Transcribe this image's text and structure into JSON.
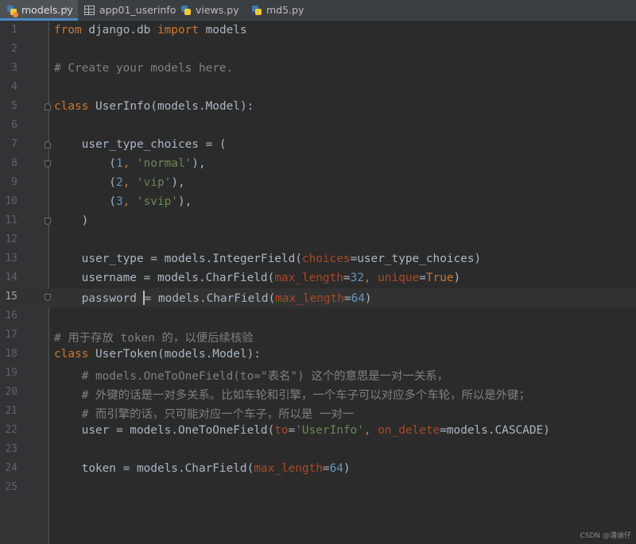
{
  "tabs": [
    {
      "label": "models.py",
      "icon": "python-file-icon",
      "active": true
    },
    {
      "label": "app01_userinfo",
      "icon": "table-icon",
      "active": false
    },
    {
      "label": "views.py",
      "icon": "python-file-icon",
      "active": false
    },
    {
      "label": "md5.py",
      "icon": "python-file-icon",
      "active": false
    }
  ],
  "tab_close_glyph": "×",
  "current_line": 15,
  "colors": {
    "background": "#2b2b2b",
    "gutter": "#313335",
    "keyword": "#cc7832",
    "comment": "#808080",
    "string": "#6a8759",
    "number": "#6897bb",
    "parameter": "#aa4926",
    "default_text": "#a9b7c6",
    "tab_underline": "#4a88c7"
  },
  "lines": [
    {
      "n": "1",
      "tokens": [
        [
          "kw",
          "from"
        ],
        [
          "",
          "django.db"
        ],
        [
          "kw",
          "import"
        ],
        [
          "",
          "models"
        ]
      ]
    },
    {
      "n": "2",
      "tokens": []
    },
    {
      "n": "3",
      "tokens": [
        [
          "cm",
          "# Create your models here."
        ]
      ]
    },
    {
      "n": "4",
      "tokens": []
    },
    {
      "n": "5",
      "tokens": [
        [
          "kw",
          "class"
        ],
        [
          "",
          "UserInfo(models.Model):"
        ]
      ]
    },
    {
      "n": "6",
      "tokens": []
    },
    {
      "n": "7",
      "tokens": [
        [
          "",
          "    user_type_choices = ("
        ]
      ]
    },
    {
      "n": "8",
      "tokens": [
        [
          "",
          "        ("
        ],
        [
          "num",
          "1"
        ],
        [
          "kw",
          ", "
        ],
        [
          "str",
          "'normal'"
        ],
        [
          "",
          "),"
        ]
      ]
    },
    {
      "n": "9",
      "tokens": [
        [
          "",
          "        ("
        ],
        [
          "num",
          "2"
        ],
        [
          "kw",
          ", "
        ],
        [
          "str",
          "'vip'"
        ],
        [
          "",
          "),"
        ]
      ]
    },
    {
      "n": "10",
      "tokens": [
        [
          "",
          "        ("
        ],
        [
          "num",
          "3"
        ],
        [
          "kw",
          ", "
        ],
        [
          "str",
          "'svip'"
        ],
        [
          "",
          "),"
        ]
      ]
    },
    {
      "n": "11",
      "tokens": [
        [
          "",
          "    )"
        ]
      ]
    },
    {
      "n": "12",
      "tokens": []
    },
    {
      "n": "13",
      "tokens": [
        [
          "",
          "    user_type = models.IntegerField("
        ],
        [
          "prm",
          "choices"
        ],
        [
          "",
          "=user_type_choices)"
        ]
      ]
    },
    {
      "n": "14",
      "tokens": [
        [
          "",
          "    username = models.CharField("
        ],
        [
          "prm",
          "max_length"
        ],
        [
          "",
          "="
        ],
        [
          "num",
          "32"
        ],
        [
          "kw",
          ", "
        ],
        [
          "prm",
          "unique"
        ],
        [
          "",
          "="
        ],
        [
          "kw",
          "True"
        ],
        [
          "",
          ")"
        ]
      ]
    },
    {
      "n": "15",
      "tokens": [
        [
          "",
          "    password "
        ],
        [
          "caret",
          ""
        ],
        [
          "",
          "= models.CharField("
        ],
        [
          "prm",
          "max_length"
        ],
        [
          "",
          "="
        ],
        [
          "num",
          "64"
        ],
        [
          "",
          ")"
        ]
      ]
    },
    {
      "n": "16",
      "tokens": []
    },
    {
      "n": "17",
      "tokens": [
        [
          "cm",
          "# 用于存放 token 的，以便后续核验"
        ]
      ]
    },
    {
      "n": "18",
      "tokens": [
        [
          "kw",
          "class"
        ],
        [
          "",
          "UserToken(models.Model):"
        ]
      ]
    },
    {
      "n": "19",
      "tokens": [
        [
          "cm",
          "    # models.OneToOneField(to=\"表名\") 这个的意思是一对一关系，"
        ]
      ]
    },
    {
      "n": "20",
      "tokens": [
        [
          "cm",
          "    # 外键的话是一对多关系。比如车轮和引擎，一个车子可以对应多个车轮，所以是外键；"
        ]
      ]
    },
    {
      "n": "21",
      "tokens": [
        [
          "cm",
          "    # 而引擎的话，只可能对应一个车子，所以是 一对一"
        ]
      ]
    },
    {
      "n": "22",
      "tokens": [
        [
          "",
          "    user = models.OneToOneField("
        ],
        [
          "prm",
          "to"
        ],
        [
          "",
          "="
        ],
        [
          "str",
          "'UserInfo'"
        ],
        [
          "kw",
          ", "
        ],
        [
          "prm",
          "on_delete"
        ],
        [
          "",
          "=models.CASCADE)"
        ]
      ]
    },
    {
      "n": "23",
      "tokens": []
    },
    {
      "n": "24",
      "tokens": [
        [
          "",
          "    token = models.CharField("
        ],
        [
          "prm",
          "max_length"
        ],
        [
          "",
          "="
        ],
        [
          "num",
          "64"
        ],
        [
          "",
          ")"
        ]
      ]
    },
    {
      "n": "25",
      "tokens": []
    }
  ],
  "fold_markers": [
    {
      "line": 5,
      "kind": "down"
    },
    {
      "line": 7,
      "kind": "down"
    },
    {
      "line": 8,
      "kind": "up"
    },
    {
      "line": 11,
      "kind": "up"
    },
    {
      "line": 15,
      "kind": "up"
    }
  ],
  "watermark": "CSDN @潘迪仔"
}
